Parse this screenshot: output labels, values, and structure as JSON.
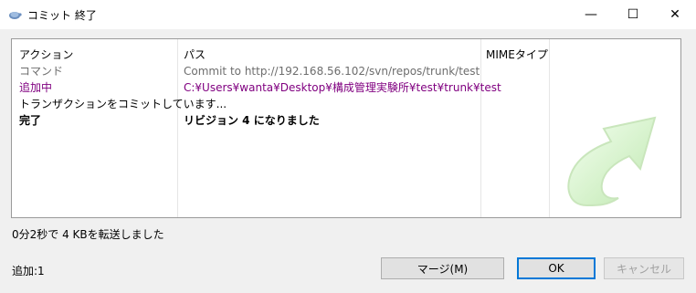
{
  "window": {
    "title": "コミット 終了",
    "controls": {
      "minimize": "—",
      "maximize": "☐",
      "close": "✕"
    }
  },
  "list": {
    "headers": {
      "action": "アクション",
      "path": "パス",
      "mime": "MIMEタイプ"
    },
    "rows": [
      {
        "action": "コマンド",
        "path": "Commit to http://192.168.56.102/svn/repos/trunk/test",
        "style": "gray"
      },
      {
        "action": "追加中",
        "path": "C:¥Users¥wanta¥Desktop¥構成管理実験所¥test¥trunk¥test",
        "style": "purple"
      },
      {
        "action": "トランザクションをコミットしています...",
        "path": "",
        "style": "normal"
      },
      {
        "action": "完了",
        "path": "リビジョン 4 になりました",
        "style": "bold"
      }
    ]
  },
  "status": "0分2秒で 4 KBを転送しました",
  "summary": "追加:1",
  "buttons": {
    "merge": "マージ(M)",
    "ok": "OK",
    "cancel": "キャンセル"
  },
  "icons": {
    "app": "tortoise-icon",
    "decoration": "commit-arrow-icon"
  },
  "colors": {
    "added": "#800080",
    "command": "#6d6d6d",
    "ok_border": "#0078d7"
  }
}
